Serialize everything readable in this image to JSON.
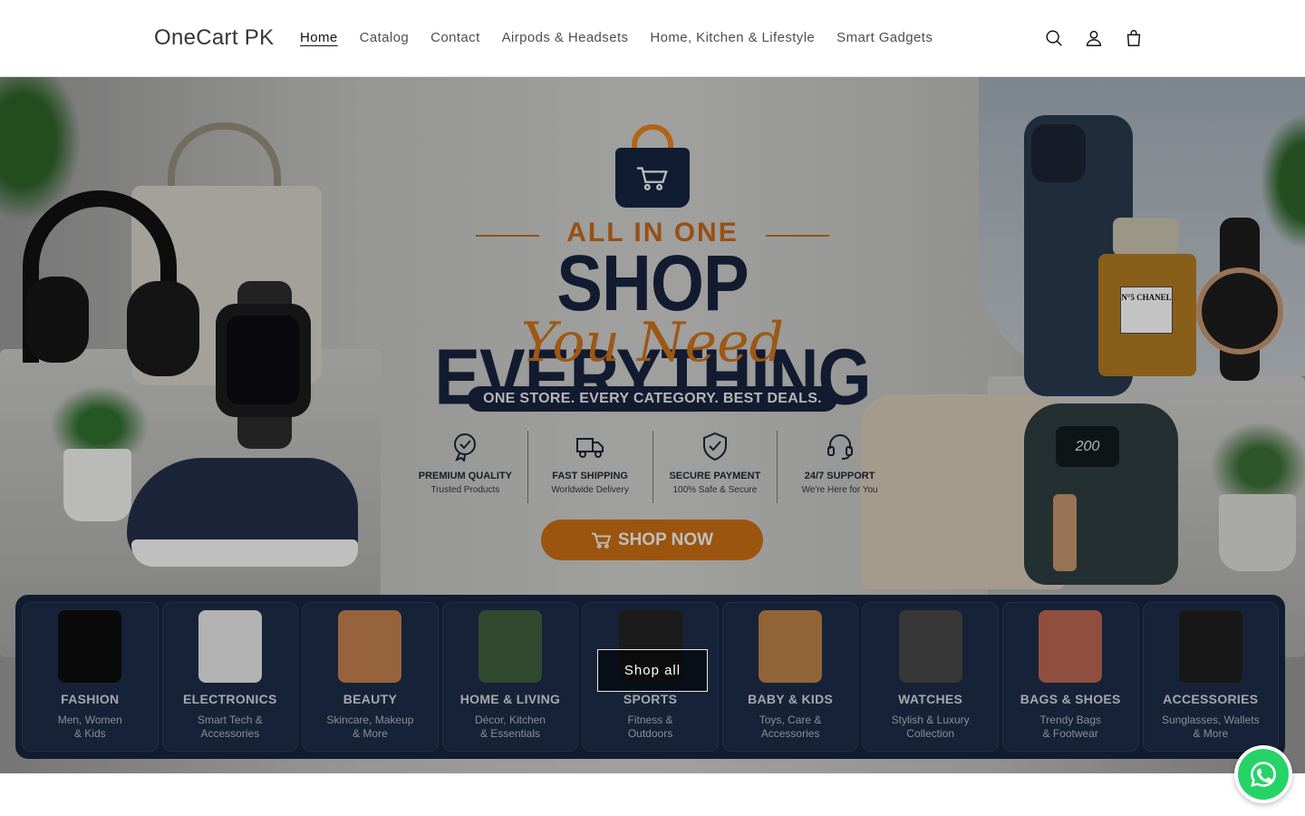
{
  "header": {
    "logo": "OneCart PK",
    "nav": [
      {
        "label": "Home",
        "active": true
      },
      {
        "label": "Catalog"
      },
      {
        "label": "Contact"
      },
      {
        "label": "Airpods & Headsets"
      },
      {
        "label": "Home, Kitchen & Lifestyle"
      },
      {
        "label": "Smart Gadgets"
      }
    ],
    "icons": [
      "search-icon",
      "account-icon",
      "cart-icon"
    ]
  },
  "hero": {
    "kicker": "ALL IN ONE",
    "headline": "SHOP EVERYTHING",
    "script": "You Need",
    "tagline": "ONE STORE. EVERY CATEGORY. BEST DEALS.",
    "perfume_label": "N°5 CHANEL",
    "fryer_display": "200",
    "features": [
      {
        "title": "PREMIUM QUALITY",
        "sub": "Trusted Products",
        "icon": "badge-check-icon"
      },
      {
        "title": "FAST SHIPPING",
        "sub": "Worldwide Delivery",
        "icon": "truck-icon"
      },
      {
        "title": "SECURE PAYMENT",
        "sub": "100% Safe & Secure",
        "icon": "shield-check-icon"
      },
      {
        "title": "24/7 SUPPORT",
        "sub": "We're Here for You",
        "icon": "headset-icon"
      }
    ],
    "cta": "SHOP NOW",
    "categories": [
      {
        "name": "FASHION",
        "sub1": "Men, Women",
        "sub2": "& Kids",
        "color": "#0d0d0d"
      },
      {
        "name": "ELECTRONICS",
        "sub1": "Smart Tech &",
        "sub2": "Accessories",
        "color": "#d9d9d9"
      },
      {
        "name": "BEAUTY",
        "sub1": "Skincare, Makeup",
        "sub2": "& More",
        "color": "#b8794a"
      },
      {
        "name": "HOME & LIVING",
        "sub1": "Décor, Kitchen",
        "sub2": "& Essentials",
        "color": "#3b5a3a"
      },
      {
        "name": "SPORTS",
        "sub1": "Fitness &",
        "sub2": "Outdoors",
        "color": "#222222"
      },
      {
        "name": "BABY & KIDS",
        "sub1": "Toys, Care &",
        "sub2": "Accessories",
        "color": "#b07a44"
      },
      {
        "name": "WATCHES",
        "sub1": "Stylish & Luxury",
        "sub2": "Collection",
        "color": "#444444"
      },
      {
        "name": "BAGS & SHOES",
        "sub1": "Trendy Bags",
        "sub2": "& Footwear",
        "color": "#b0604c"
      },
      {
        "name": "ACCESSORIES",
        "sub1": "Sunglasses, Wallets",
        "sub2": "& More",
        "color": "#1d1d1d"
      }
    ],
    "shop_all": "Shop all"
  },
  "colors": {
    "accent": "#d87a1a",
    "navy": "#16223b",
    "whatsapp": "#25d366"
  }
}
